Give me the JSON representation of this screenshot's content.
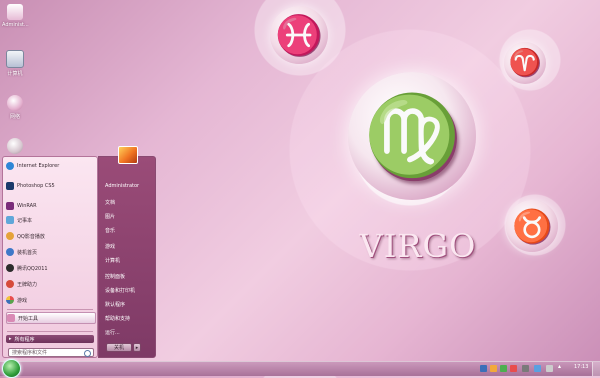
{
  "desktop": {
    "icons": [
      {
        "label": "Administ...",
        "color": "#f1d3e4"
      },
      {
        "label": "计算机",
        "color": "#d3d9e6"
      },
      {
        "label": "网络",
        "color": "#a3c9ea"
      },
      {
        "label": "",
        "color": "#e7dbe1"
      }
    ]
  },
  "wallpaper": {
    "main_symbol": "♍",
    "small_symbols": [
      "♓",
      "♈",
      "♉",
      "♌"
    ],
    "title": "VIRGO"
  },
  "start_menu": {
    "programs": [
      {
        "label": "Internet Explorer",
        "icon": "ie-icon",
        "color": "#2f86d6"
      },
      {
        "label": "Photoshop CS5",
        "icon": "photoshop-icon",
        "color": "#1b3a6b"
      },
      {
        "label": "WinRAR",
        "icon": "winrar-icon",
        "color": "#7b2c7a"
      },
      {
        "label": "记事本",
        "icon": "notepad-icon",
        "color": "#5fa7d9"
      },
      {
        "label": "QQ影音播放",
        "icon": "qqplayer-icon",
        "color": "#e5a23a"
      },
      {
        "label": "装机首页",
        "icon": "homepage-icon",
        "color": "#3f78c8"
      },
      {
        "label": "腾讯QQ2011",
        "icon": "qq-icon",
        "color": "#2c2c2c"
      },
      {
        "label": "王牌助力",
        "icon": "assistant-icon",
        "color": "#d64b3b"
      },
      {
        "label": "游戏",
        "icon": "games-icon",
        "color": "#5aa34c"
      },
      {
        "label": "开始工具",
        "icon": "tools-icon",
        "color": "#d98ab5"
      }
    ],
    "all_programs_label": "所有程序",
    "search_placeholder": "搜索程序和文件",
    "user_name": "Administrator",
    "right_items": [
      "文档",
      "图片",
      "音乐",
      "游戏",
      "计算机",
      "控制面板",
      "设备和打印机",
      "默认程序",
      "帮助和支持",
      "运行..."
    ],
    "shutdown_label": "关机",
    "shutdown_arrow": "▸"
  },
  "taskbar": {
    "clock": "17:13",
    "tray_colors": [
      "#3b6fb8",
      "#f2a93b",
      "#4caf50",
      "#e84d4d",
      "#7a7a7a",
      "#5aa0e0",
      "#cccccc"
    ]
  }
}
